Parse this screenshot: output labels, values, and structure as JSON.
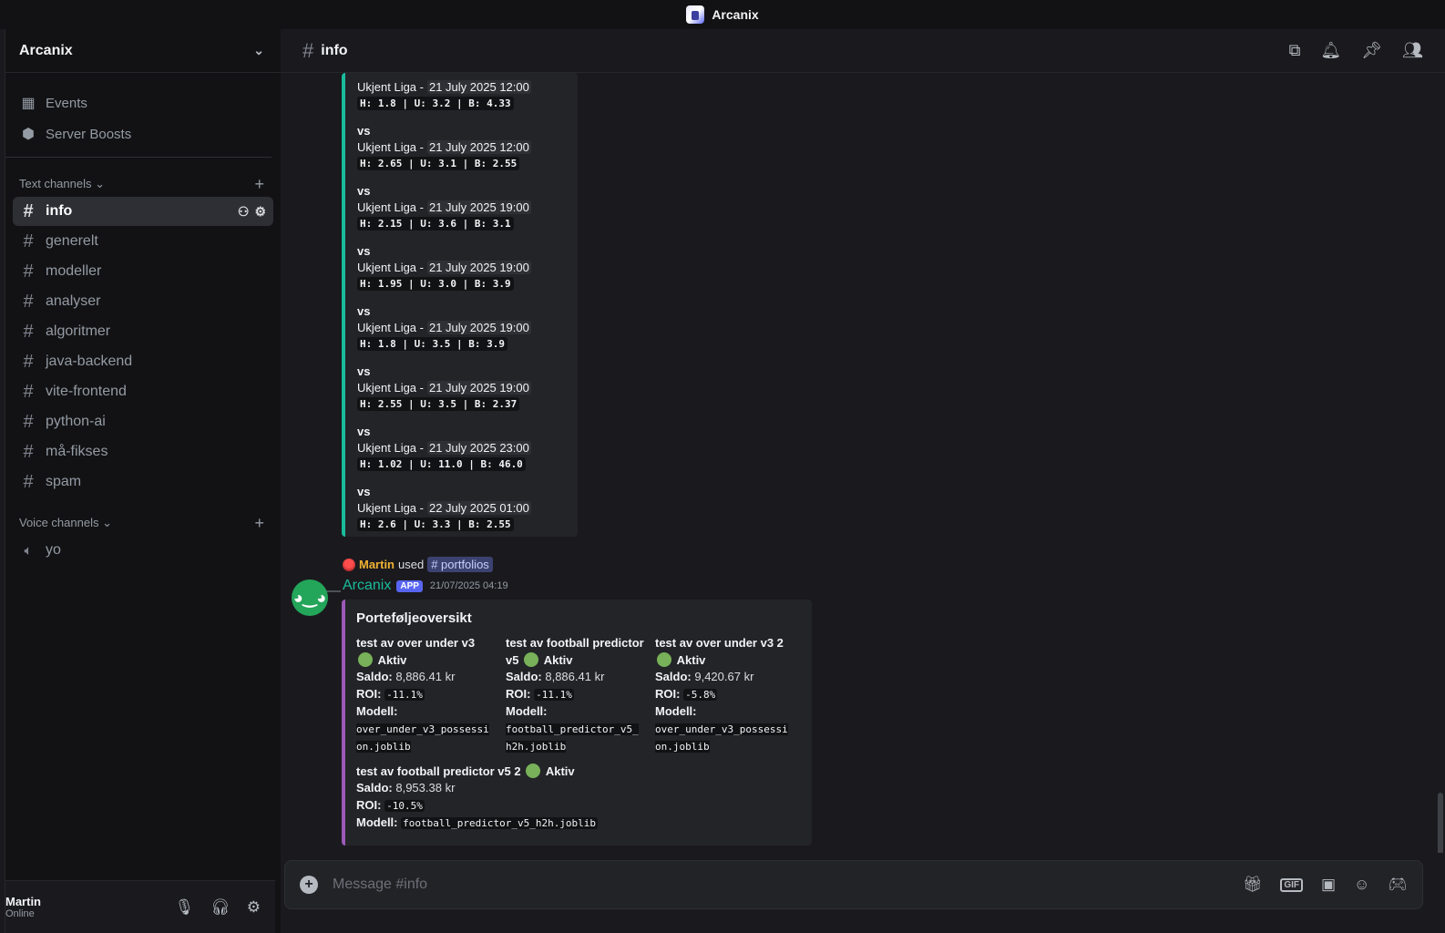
{
  "window": {
    "title": "Arcanix"
  },
  "server": {
    "name": "Arcanix"
  },
  "side_links": [
    {
      "label": "Events",
      "icon": "calendar-icon"
    },
    {
      "label": "Server Boosts",
      "icon": "boost-icon"
    }
  ],
  "text_category": "Text channels",
  "text_channels": [
    "info",
    "generelt",
    "modeller",
    "analyser",
    "algoritmer",
    "java-backend",
    "vite-frontend",
    "python-ai",
    "må-fikses",
    "spam"
  ],
  "voice_category": "Voice channels",
  "voice_channels": [
    "yo"
  ],
  "user": {
    "name": "Martin",
    "status": "Online"
  },
  "channel_header": {
    "name": "info"
  },
  "matches": {
    "first": {
      "league": "Ukjent Liga -",
      "date": "21 July 2025 12:00",
      "odds": "H: 1.8 | U: 3.2 | B: 4.33"
    },
    "rest": [
      {
        "vs": "vs",
        "league": "Ukjent Liga -",
        "date": "21 July 2025 12:00",
        "odds": "H: 2.65 | U: 3.1 | B: 2.55"
      },
      {
        "vs": "vs",
        "league": "Ukjent Liga -",
        "date": "21 July 2025 19:00",
        "odds": "H: 2.15 | U: 3.6 | B: 3.1"
      },
      {
        "vs": "vs",
        "league": "Ukjent Liga -",
        "date": "21 July 2025 19:00",
        "odds": "H: 1.95 | U: 3.0 | B: 3.9"
      },
      {
        "vs": "vs",
        "league": "Ukjent Liga -",
        "date": "21 July 2025 19:00",
        "odds": "H: 1.8 | U: 3.5 | B: 3.9"
      },
      {
        "vs": "vs",
        "league": "Ukjent Liga -",
        "date": "21 July 2025 19:00",
        "odds": "H: 2.55 | U: 3.5 | B: 2.37"
      },
      {
        "vs": "vs",
        "league": "Ukjent Liga -",
        "date": "21 July 2025 23:00",
        "odds": "H: 1.02 | U: 11.0 | B: 46.0"
      },
      {
        "vs": "vs",
        "league": "Ukjent Liga -",
        "date": "22 July 2025 01:00",
        "odds": "H: 2.6 | U: 3.3 | B: 2.55"
      }
    ]
  },
  "reply": {
    "author": "Martin",
    "used": "used",
    "command": "portfolios"
  },
  "bot_message": {
    "author": "Arcanix",
    "badge": "APP",
    "timestamp": "21/07/2025 04:19"
  },
  "portfolio": {
    "title": "Porteføljeoversikt",
    "saldo_label": "Saldo:",
    "roi_label": "ROI:",
    "model_label": "Modell:",
    "items": [
      {
        "name": "test av over under v3",
        "status": "Aktiv",
        "saldo": "8,886.41 kr",
        "roi": "-11.1%",
        "model": "over_under_v3_possession.joblib"
      },
      {
        "name": "test av football predictor v5",
        "status": "Aktiv",
        "saldo": "8,886.41 kr",
        "roi": "-11.1%",
        "model": "football_predictor_v5_h2h.joblib"
      },
      {
        "name": "test av over under v3 2",
        "status": "Aktiv",
        "saldo": "9,420.67 kr",
        "roi": "-5.8%",
        "model": "over_under_v3_possession.joblib"
      },
      {
        "name": "test av football predictor v5 2",
        "status": "Aktiv",
        "saldo": "8,953.38 kr",
        "roi": "-10.5%",
        "model": "football_predictor_v5_h2h.joblib"
      }
    ]
  },
  "composer": {
    "placeholder": "Message #info"
  },
  "colors": {
    "accent_teal": "#1abc9c",
    "accent_purple": "#9b59b6",
    "brand": "#5865f2",
    "online_green": "#23a55a"
  }
}
